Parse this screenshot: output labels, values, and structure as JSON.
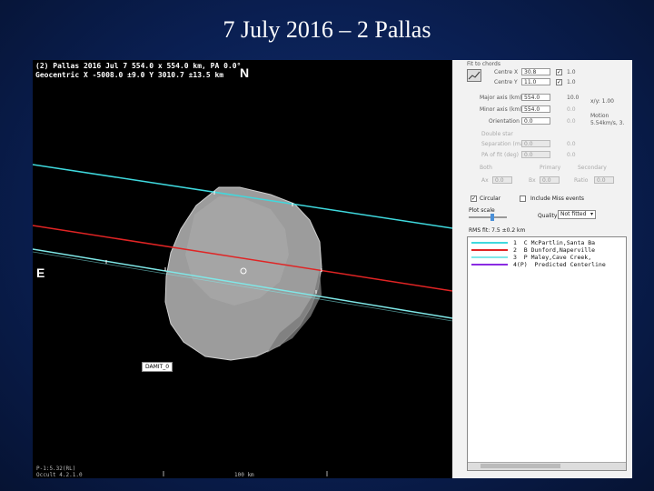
{
  "slide": {
    "title": "7 July 2016 – 2 Pallas"
  },
  "plot": {
    "header_line1": "(2) Pallas  2016 Jul 7  554.0 x 554.0 km, PA 0.0°",
    "header_line2": "Geocentric X -5008.0 ±9.0  Y 3010.7 ±13.5 km",
    "north_label": "N",
    "east_label": "E",
    "model_label": "DAMIT_0",
    "footer_left1": "P-1:5.32(RL)",
    "footer_left2": "Occult 4.2.1.0",
    "footer_mid": "100 km",
    "chords": [
      {
        "id": 1,
        "color": "#3fd9de"
      },
      {
        "id": 2,
        "color": "#e02424"
      },
      {
        "id": 3,
        "color": "#7fe8e8"
      },
      {
        "id": 4,
        "color": "#8a2be2"
      }
    ]
  },
  "panel": {
    "section_fit": "Fit to chords",
    "centre_x_label": "Centre X",
    "centre_x_value": "30.8",
    "centre_x_step": "1.0",
    "centre_y_label": "Centre Y",
    "centre_y_value": "11.0",
    "centre_y_step": "1.0",
    "major_label": "Major axis (km)",
    "major_value": "554.0",
    "major_step": "10.0",
    "minor_label": "Minor axis (km)",
    "minor_value": "554.0",
    "minor_step": "0.0",
    "orient_label": "Orientation",
    "orient_value": "0.0",
    "orient_step": "0.0",
    "scale_label": "x/y: 1.00",
    "motion_label": "Motion",
    "motion_value": "5.54km/s, 3.",
    "double_label": "Double star",
    "sep_label": "Separation (mas)",
    "pa_label": "PA of fit (deg)",
    "sep_value": "0.0",
    "pa_value": "0.0",
    "sep_step": "0.0",
    "pa_step": "0.0",
    "radio_both": "Both",
    "radio_primary": "Primary",
    "radio_secondary": "Secondary",
    "ax_label": "Ax",
    "ax_value": "0.0",
    "bx_label": "Bx",
    "bx_value": "0.0",
    "ratio_label": "Ratio",
    "ratio_value": "0.0",
    "circular_label": "Circular",
    "circular_checked": "✓",
    "include_miss_label": "Include Miss events",
    "plot_scale_label": "Plot scale",
    "quality_label": "Quality",
    "quality_value": "Not fitted",
    "rms_label": "RMS fit: 7.5 ±0.2 km",
    "legend": [
      {
        "num": "1",
        "name": "C McPartlin,Santa Ba",
        "color": "#3fd9de"
      },
      {
        "num": "2",
        "name": "B Dunford,Naperville",
        "color": "#e02424"
      },
      {
        "num": "3",
        "name": "P Maley,Cave Creek,",
        "color": "#7fe8e8"
      },
      {
        "num": "4(P)",
        "name": "Predicted Centerline",
        "color": "#8a2be2"
      }
    ]
  }
}
